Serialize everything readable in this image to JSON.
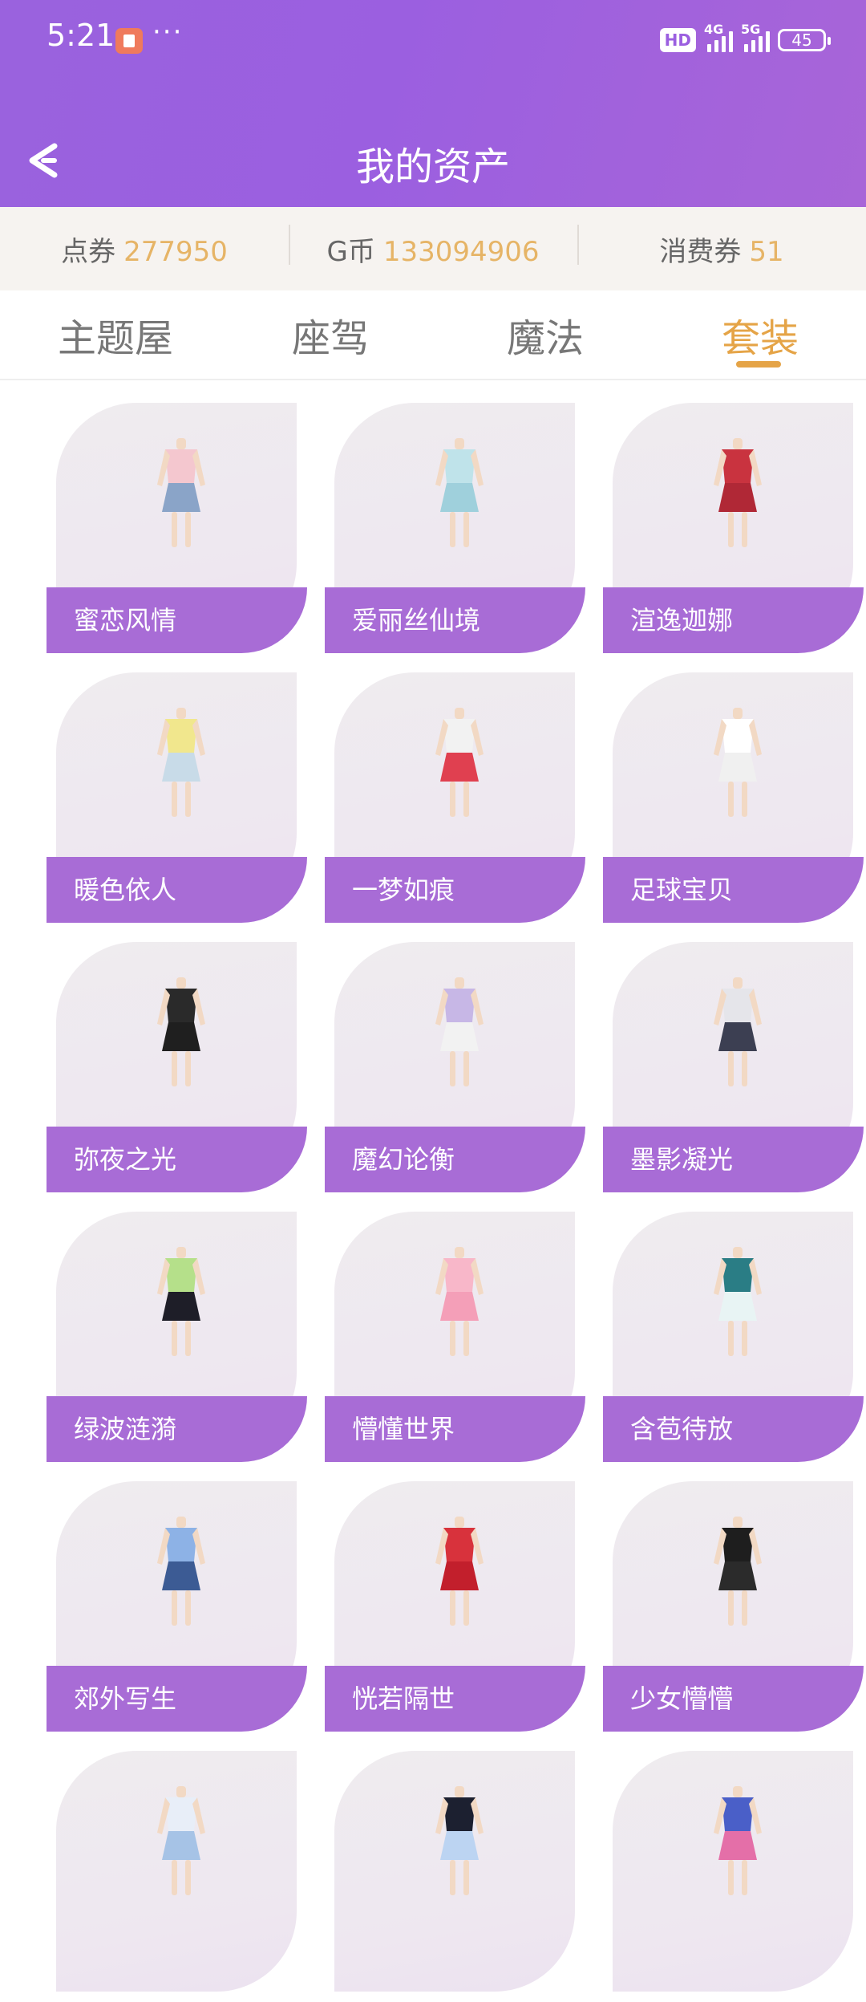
{
  "status_bar": {
    "time": "5:21",
    "dots": "···",
    "hd": "HD",
    "net1": "4G",
    "net2": "5G",
    "battery": "45"
  },
  "header": {
    "title": "我的资产"
  },
  "assets": [
    {
      "label": "点券",
      "value": "277950"
    },
    {
      "label": "G币",
      "value": "133094906"
    },
    {
      "label": "消费券",
      "value": "51"
    }
  ],
  "tabs": [
    {
      "label": "主题屋",
      "active": false
    },
    {
      "label": "座驾",
      "active": false
    },
    {
      "label": "魔法",
      "active": false
    },
    {
      "label": "套装",
      "active": true
    }
  ],
  "outfits": [
    {
      "name": "蜜恋风情",
      "top": "#f4c7cf",
      "bottom": "#8aa4c8"
    },
    {
      "name": "爱丽丝仙境",
      "top": "#bfe3ea",
      "bottom": "#9fd0dc"
    },
    {
      "name": "渲逸迦娜",
      "top": "#c9333f",
      "bottom": "#b02836"
    },
    {
      "name": "暖色依人",
      "top": "#f1e78d",
      "bottom": "#c8dbe8"
    },
    {
      "name": "一梦如痕",
      "top": "#f2f2f2",
      "bottom": "#e04050"
    },
    {
      "name": "足球宝贝",
      "top": "#ffffff",
      "bottom": "#f0f0f0"
    },
    {
      "name": "弥夜之光",
      "top": "#2a2a2a",
      "bottom": "#1f1f1f"
    },
    {
      "name": "魔幻论衡",
      "top": "#c7b7e6",
      "bottom": "#f2f2f2"
    },
    {
      "name": "墨影凝光",
      "top": "#e5e5ea",
      "bottom": "#3c3f52"
    },
    {
      "name": "绿波涟漪",
      "top": "#b5e08a",
      "bottom": "#1e1e28"
    },
    {
      "name": "懵懂世界",
      "top": "#f8b7c9",
      "bottom": "#f49fb8"
    },
    {
      "name": "含苞待放",
      "top": "#2a7d85",
      "bottom": "#e8f4f4"
    },
    {
      "name": "郊外写生",
      "top": "#8db2e6",
      "bottom": "#3c5b94"
    },
    {
      "name": "恍若隔世",
      "top": "#d8323c",
      "bottom": "#c21f2c"
    },
    {
      "name": "少女懵懵",
      "top": "#1e1e1e",
      "bottom": "#2b2b2b"
    },
    {
      "name": "",
      "top": "#e8eef8",
      "bottom": "#a6c3e6"
    },
    {
      "name": "",
      "top": "#1c2030",
      "bottom": "#bcd4f2"
    },
    {
      "name": "",
      "top": "#4a5fc8",
      "bottom": "#e46fa8"
    }
  ]
}
